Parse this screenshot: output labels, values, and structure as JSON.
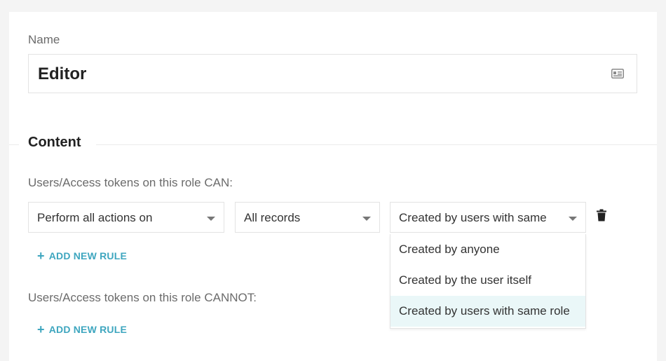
{
  "name_section": {
    "label": "Name",
    "value": "Editor",
    "icon": "id-card-icon"
  },
  "content_section": {
    "title": "Content",
    "can_label": "Users/Access tokens on this role CAN:",
    "cannot_label": "Users/Access tokens on this role CANNOT:",
    "rule": {
      "action": "Perform all actions on",
      "scope": "All records",
      "owner": "Created by users with same"
    },
    "add_rule_label": "ADD NEW RULE",
    "owner_options": [
      {
        "label": "Created by anyone"
      },
      {
        "label": "Created by the user itself"
      },
      {
        "label": "Created by users with same role"
      }
    ],
    "selected_option_index": 2
  },
  "colors": {
    "accent": "#3ea6bf",
    "selected_bg": "#eaf7f8"
  }
}
